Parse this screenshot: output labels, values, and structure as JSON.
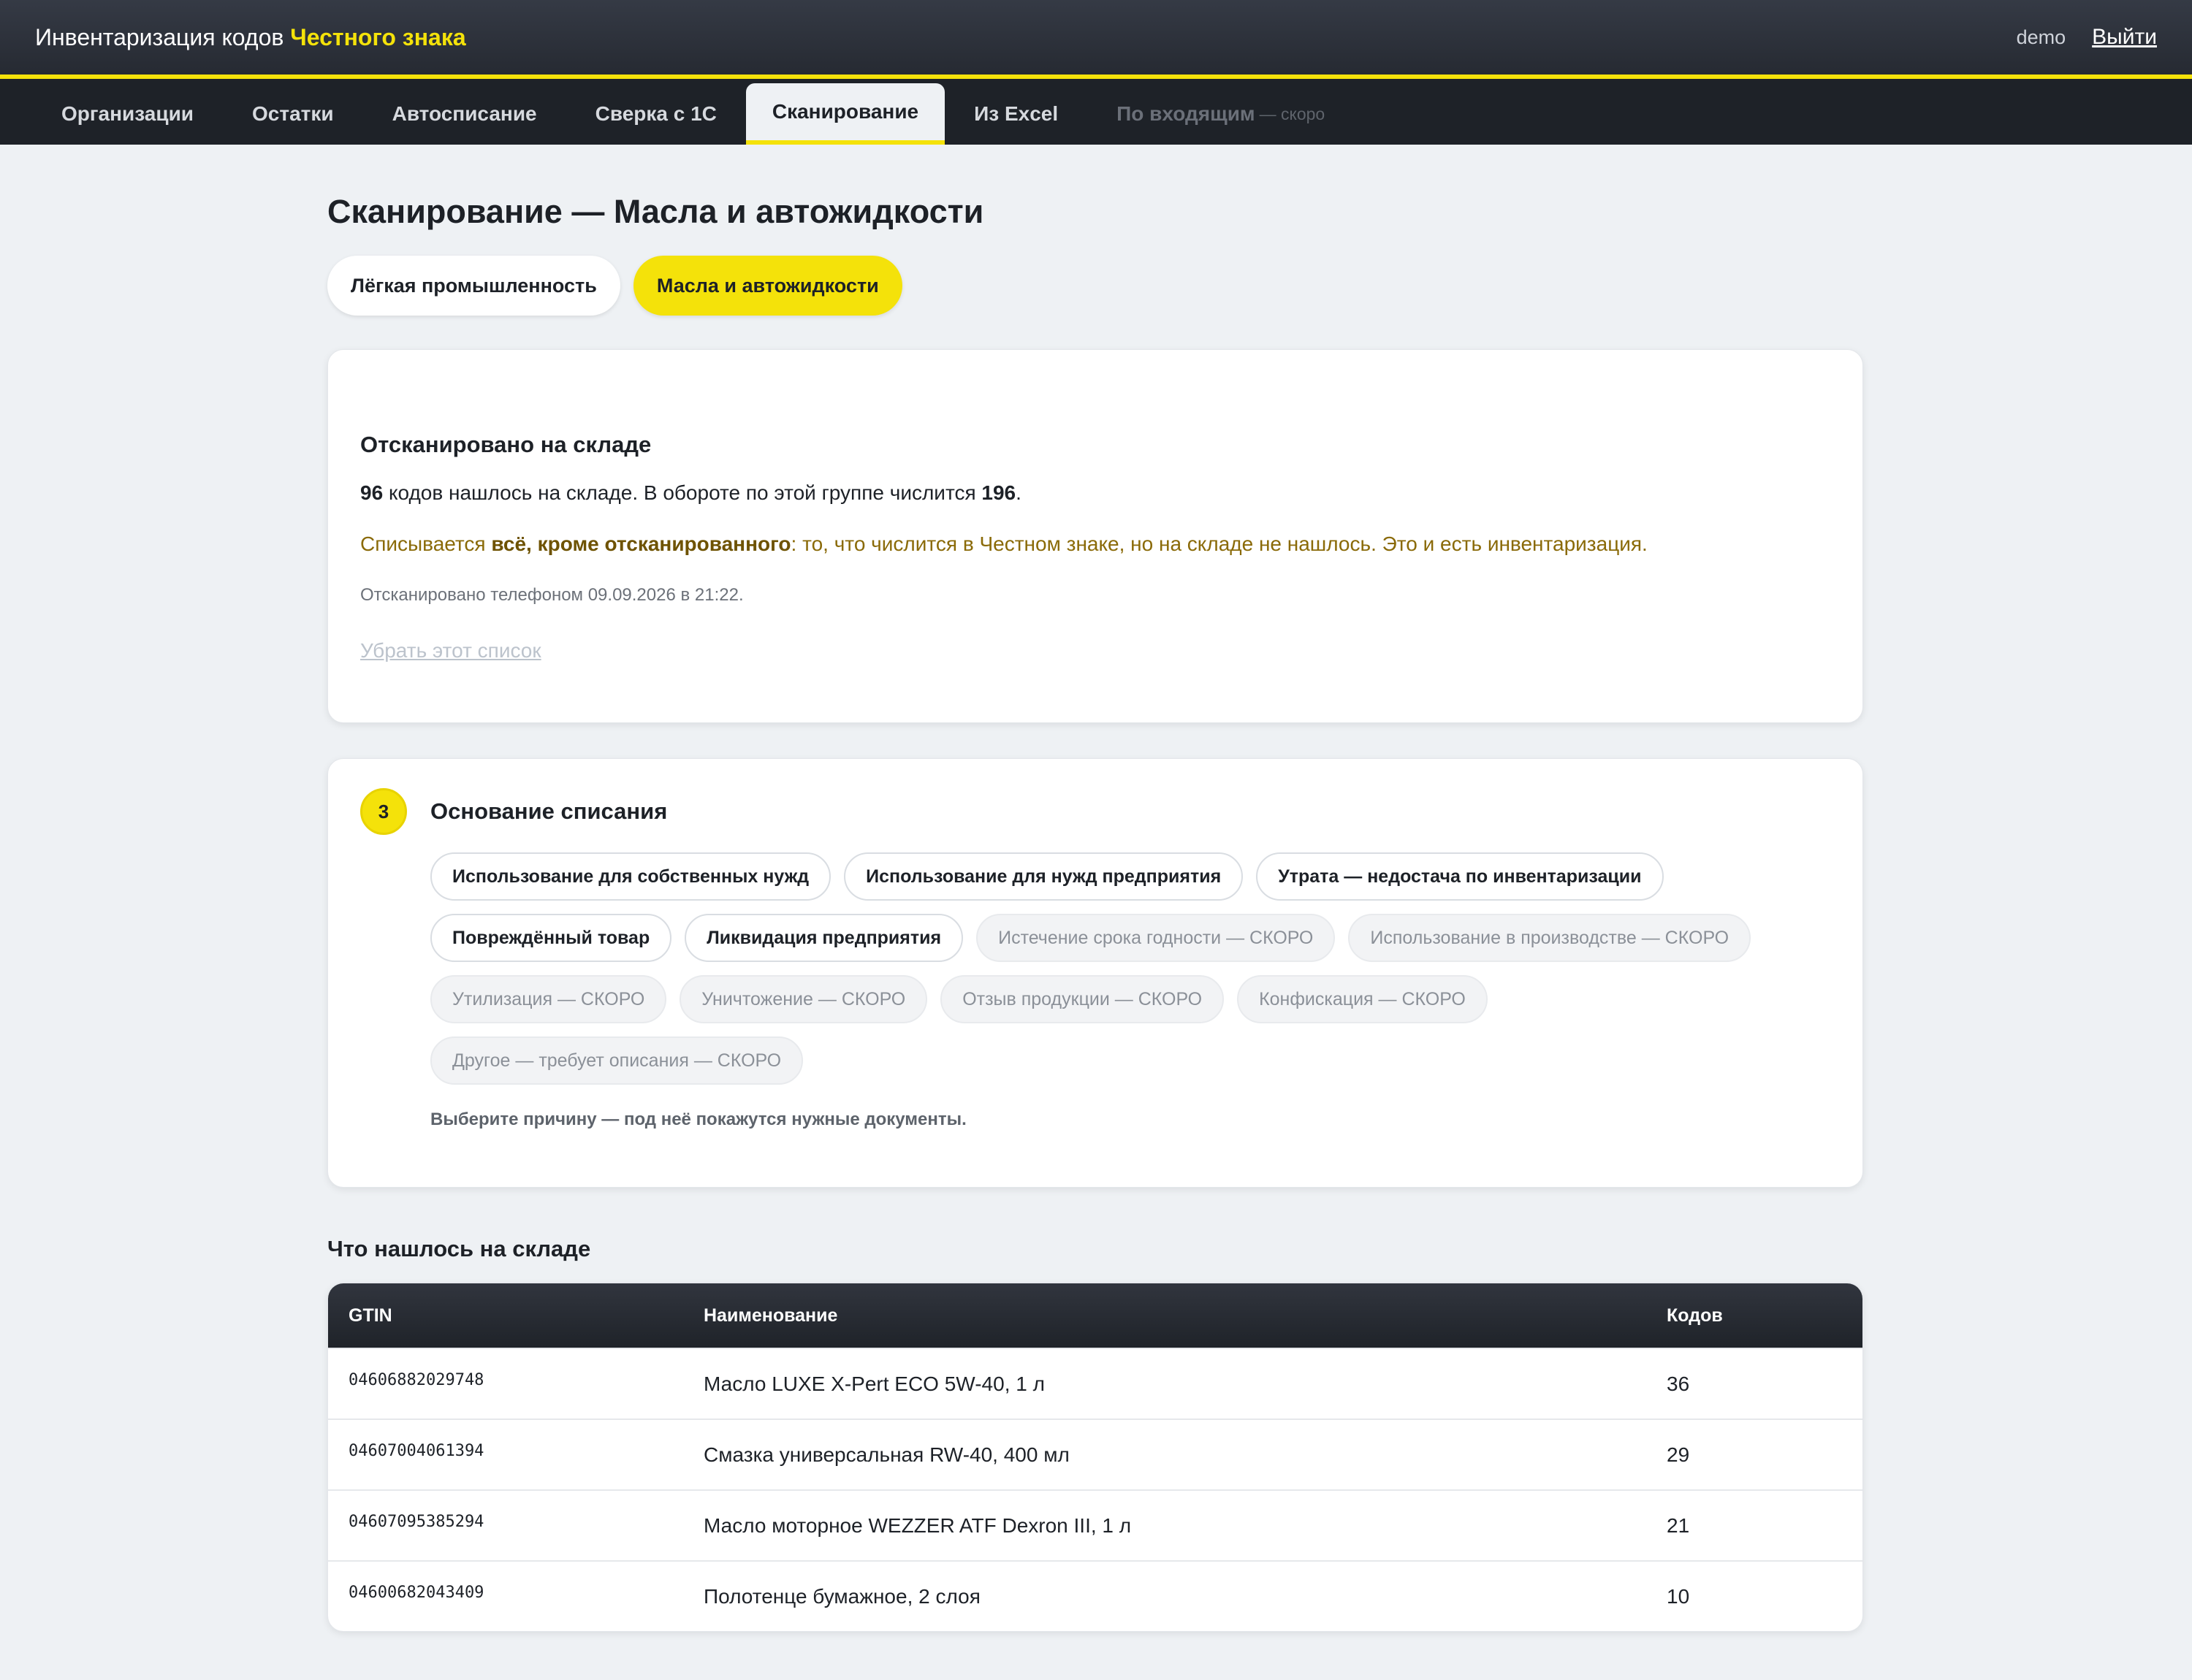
{
  "header": {
    "title_prefix": "Инвентаризация кодов",
    "title_brand": "Честного знака",
    "user": "demo",
    "logout_label": "Выйти"
  },
  "nav": {
    "items": [
      {
        "label": "Организации"
      },
      {
        "label": "Остатки"
      },
      {
        "label": "Автосписание"
      },
      {
        "label": "Сверка с 1С"
      },
      {
        "label": "Сканирование"
      },
      {
        "label": "Из Excel"
      }
    ],
    "disabled_label": "По входящим",
    "disabled_note": "— скоро"
  },
  "page": {
    "title": "Сканирование — Масла и автожидкости",
    "groups": [
      "Лёгкая промышленность",
      "Масла и автожидкости"
    ]
  },
  "scan": {
    "title": "Отсканировано на складе",
    "found_count": "96",
    "found_text": "кодов нашлось на складе. В обороте по этой группе числится",
    "total_count": "196",
    "writeoff_prefix": "Списывается",
    "writeoff_bold": "всё, кроме отсканированного",
    "writeoff_rest": ": то, что числится в Честном знаке, но на складе не нашлось. Это и есть инвентаризация.",
    "meta": "Отсканировано телефоном 09.09.2026 в 21:22.",
    "remove_label": "Убрать этот список"
  },
  "reason": {
    "step": "3",
    "title": "Основание списания",
    "chips": [
      "Использование для собственных нужд",
      "Использование для нужд предприятия",
      "Утрата — недостача по инвентаризации",
      "Повреждённый товар",
      "Ликвидация предприятия"
    ],
    "soon_chips": [
      "Истечение срока годности — СКОРО",
      "Использование в производстве — СКОРО",
      "Утилизация — СКОРО",
      "Уничтожение — СКОРО",
      "Отзыв продукции — СКОРО",
      "Конфискация — СКОРО",
      "Другое — требует описания — СКОРО"
    ],
    "hint": "Выберите причину — под неё покажутся нужные документы."
  },
  "found": {
    "title": "Что нашлось на складе",
    "columns": [
      "GTIN",
      "Наименование",
      "Кодов"
    ],
    "rows": [
      {
        "gtin": "04606882029748",
        "name": "Масло LUXE X-Pert ECO 5W-40, 1 л",
        "codes": "36"
      },
      {
        "gtin": "04607004061394",
        "name": "Смазка универсальная RW-40, 400 мл",
        "codes": "29"
      },
      {
        "gtin": "04607095385294",
        "name": "Масло моторное WEZZER ATF Dexron III, 1 л",
        "codes": "21"
      },
      {
        "gtin": "04600682043409",
        "name": "Полотенце бумажное, 2 слоя",
        "codes": "10"
      }
    ]
  }
}
